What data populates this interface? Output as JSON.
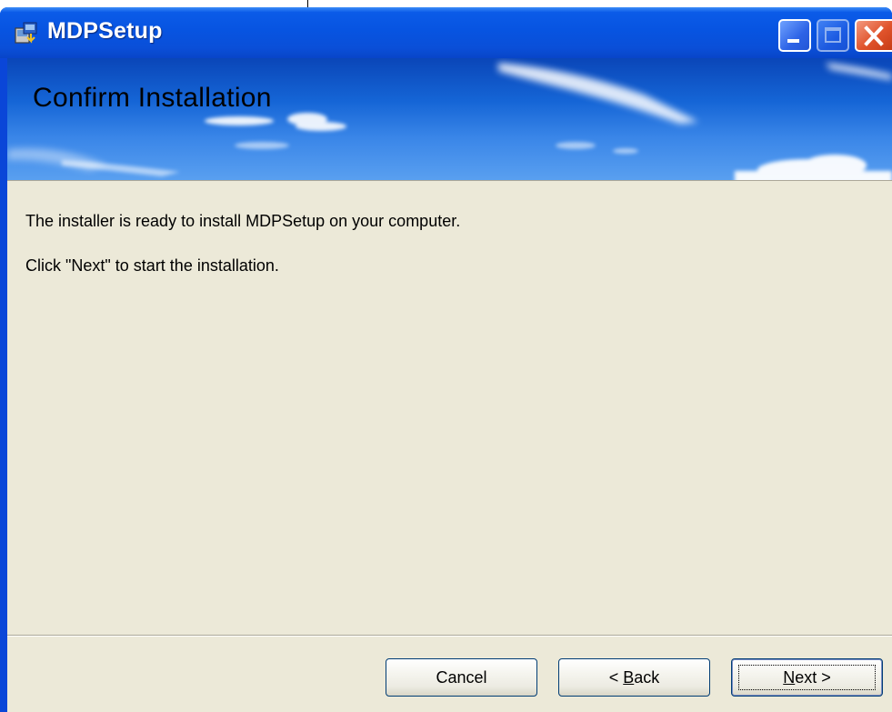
{
  "window": {
    "title": "MDPSetup",
    "app_icon": "installer-package-icon",
    "controls": {
      "minimize_icon": "minimize-icon",
      "maximize_icon": "maximize-icon",
      "close_icon": "close-icon"
    },
    "colors": {
      "titlebar": "#0754e1",
      "close_button": "#e0532b",
      "dialog_background": "#ece9d8"
    }
  },
  "banner": {
    "title": "Confirm Installation",
    "background": "blue-sky-with-clouds"
  },
  "body": {
    "line1": "The installer is ready to install MDPSetup on your computer.",
    "line2": "Click \"Next\" to start the installation."
  },
  "buttons": {
    "cancel": {
      "label": "Cancel"
    },
    "back": {
      "prefix": "< ",
      "accel": "B",
      "rest": "ack"
    },
    "next": {
      "accel": "N",
      "rest": "ext",
      "suffix": " >"
    }
  }
}
